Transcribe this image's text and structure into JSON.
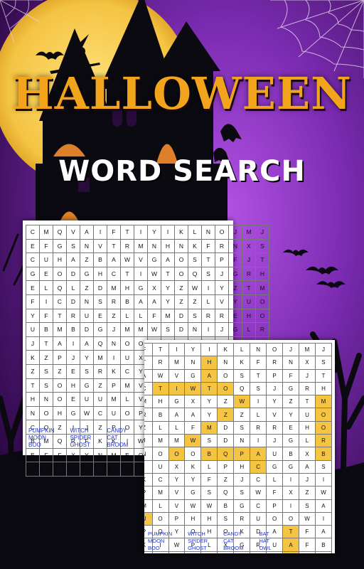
{
  "header": {
    "title": "HALLOWEEN",
    "subtitle": "WORD SEARCH"
  },
  "colors": {
    "moon": "#f4c843",
    "sky_top": "#3b0d5a",
    "sky_glow": "#9b3fd6",
    "silhouette": "#0b0a10",
    "window": "#e07f2a",
    "title": "#f2a51c",
    "highlight": "#f5c542",
    "word_list": "#2233cc"
  },
  "puzzle": {
    "grid": [
      "CMQVAIFTIYIKLNOJMJ",
      "EFGSNVTRMNHNKFRNXS",
      "CUHAZBAWVGAOSTPFJT",
      "GEODGHCTIWTOQSJGRH",
      "ELQLZDMHGXYZWIYZTM",
      "FICDNSRBAAYZZLVYUO",
      "YFTRUEZLLFMDSRREHO",
      "UBMBDGJMMWSDNIJGLR",
      "JTAIAQNOOOBQPAUBXB",
      "KZPJYMIUXKLPHCGGAS",
      "ZSZESRKCYYFZJCLIJI",
      "TSOHGZPMVGSQSWFXZW",
      "HNOEUUMLVWWBGCPISA",
      "NOHGWCUOPHHSRUOOWI",
      "COZIJZPOYOHOKDATFA",
      "BMQRFKKIWPLXGRUAFB",
      "EFFXYNMEOLJXQSRBLA",
      "HFOOAWDANYKEEBHLNG"
    ],
    "words": [
      "PUMPKIN",
      "WITCH",
      "CANDY",
      "BAT",
      "MOON",
      "SPIDER",
      "CAT",
      "HAT",
      "BOO",
      "GHOST",
      "BROOM",
      "OWL"
    ]
  },
  "answer_key": {
    "highlights": [
      [
        1,
        10
      ],
      [
        2,
        10
      ],
      [
        3,
        10
      ],
      [
        3,
        7
      ],
      [
        3,
        8
      ],
      [
        3,
        9
      ],
      [
        3,
        10
      ],
      [
        3,
        11
      ],
      [
        4,
        12
      ],
      [
        4,
        17
      ],
      [
        5,
        11
      ],
      [
        5,
        17
      ],
      [
        6,
        10
      ],
      [
        6,
        17
      ],
      [
        7,
        9
      ],
      [
        7,
        17
      ],
      [
        8,
        8
      ],
      [
        8,
        10
      ],
      [
        8,
        11
      ],
      [
        8,
        12
      ],
      [
        8,
        13
      ],
      [
        8,
        17
      ],
      [
        9,
        13
      ],
      [
        11,
        0
      ],
      [
        11,
        1
      ],
      [
        11,
        2
      ],
      [
        11,
        3
      ],
      [
        11,
        4
      ],
      [
        12,
        5
      ],
      [
        13,
        6
      ],
      [
        14,
        15
      ],
      [
        15,
        15
      ],
      [
        16,
        15
      ]
    ]
  }
}
